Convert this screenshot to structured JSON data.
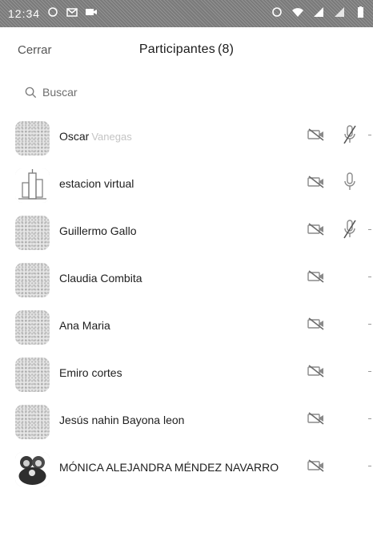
{
  "status_bar": {
    "time": "12:34"
  },
  "header": {
    "close_label": "Cerrar",
    "title": "Participantes",
    "count": "(8)"
  },
  "search": {
    "placeholder": "Buscar"
  },
  "participants": [
    {
      "name": "Oscar",
      "sub": "Vanegas",
      "avatar": "blank",
      "video": "off",
      "mic": "muted"
    },
    {
      "name": "estacion virtual",
      "sub": "",
      "avatar": "tower",
      "video": "off",
      "mic": "on"
    },
    {
      "name": "Guillermo Gallo",
      "sub": "",
      "avatar": "blank",
      "video": "off",
      "mic": "muted"
    },
    {
      "name": "Claudia Combita",
      "sub": "",
      "avatar": "blank",
      "video": "off",
      "mic": "none"
    },
    {
      "name": "Ana Maria",
      "sub": "",
      "avatar": "blank",
      "video": "off",
      "mic": "none"
    },
    {
      "name": "Emiro cortes",
      "sub": "",
      "avatar": "blank",
      "video": "off",
      "mic": "none"
    },
    {
      "name": "Jesús nahin Bayona leon",
      "sub": "",
      "avatar": "blank",
      "video": "off",
      "mic": "none"
    },
    {
      "name": "MÓNICA ALEJANDRA MÉNDEZ NAVARRO",
      "sub": "",
      "avatar": "photo",
      "video": "off",
      "mic": "none"
    }
  ],
  "colors": {
    "status_bar_bg": "#7a7a7a",
    "text": "#1e1e1e",
    "icon": "#8a8a8a"
  }
}
